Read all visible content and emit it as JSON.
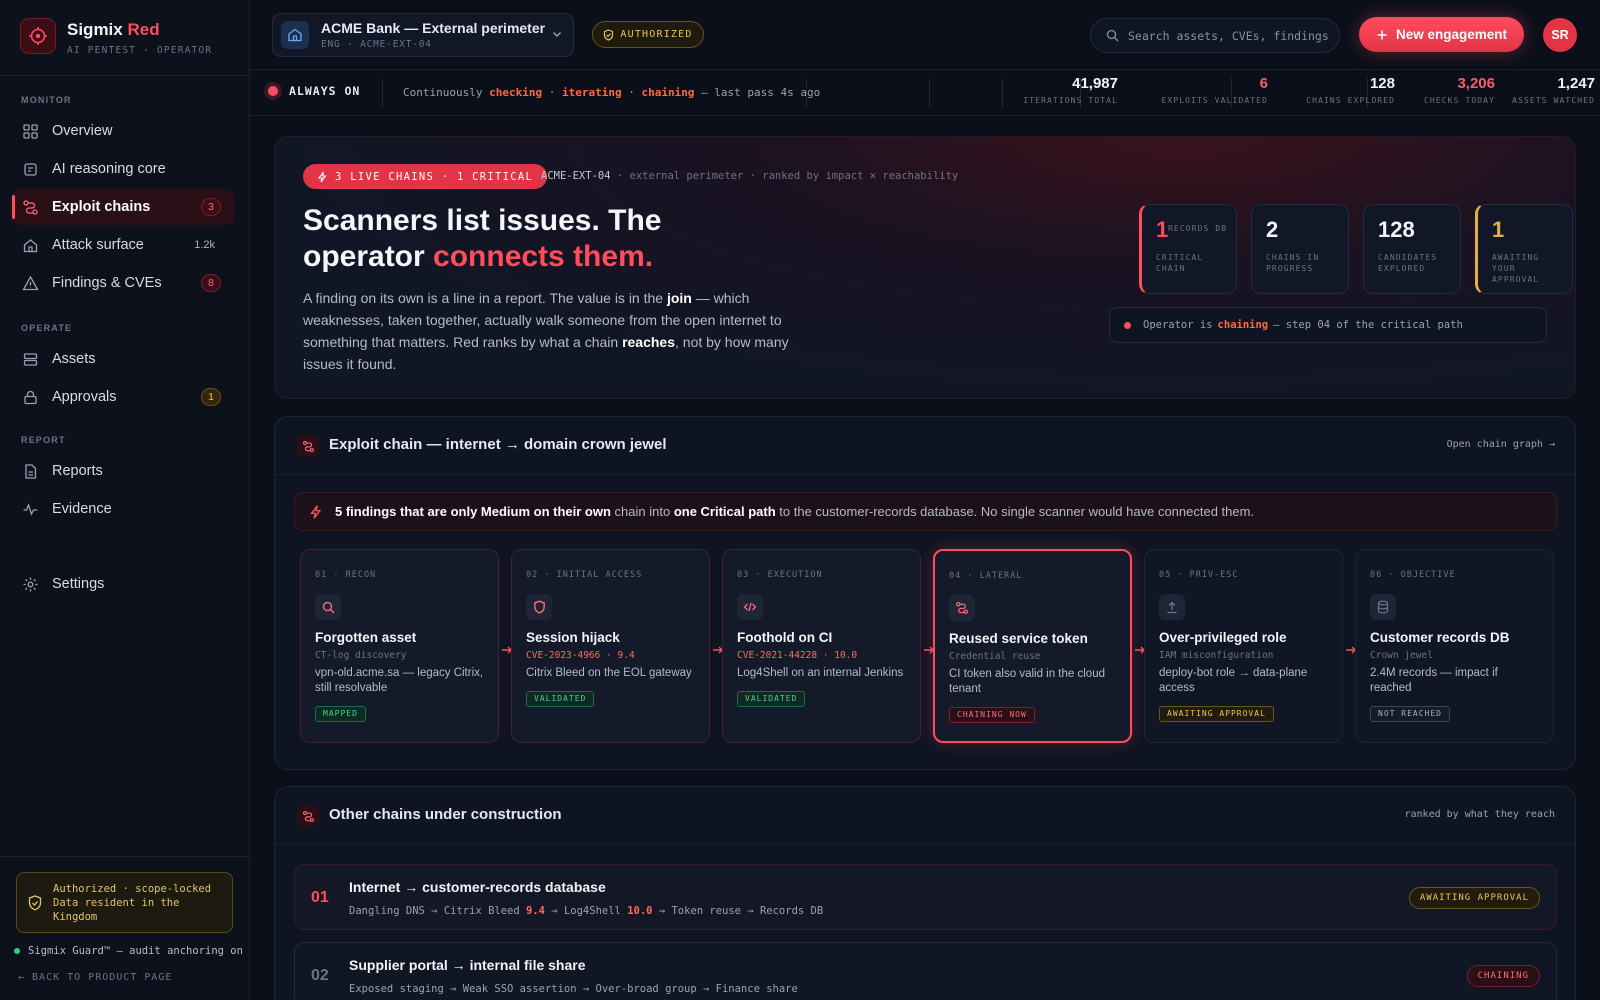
{
  "brand": {
    "name_main": "Sigmix",
    "name_accent": "Red",
    "subtitle": "AI PENTEST · OPERATOR"
  },
  "sidebar": {
    "sections": {
      "monitor": "MONITOR",
      "operate": "OPERATE",
      "report": "REPORT"
    },
    "items": [
      {
        "label": "Overview",
        "icon": "grid-icon"
      },
      {
        "label": "AI reasoning core",
        "icon": "chip-icon"
      },
      {
        "label": "Exploit chains",
        "icon": "route-icon",
        "badge": "3",
        "active": true
      },
      {
        "label": "Attack surface",
        "icon": "house-icon",
        "badge": "1.2k"
      },
      {
        "label": "Findings & CVEs",
        "icon": "warning-icon",
        "badge": "8"
      },
      {
        "label": "Assets",
        "icon": "server-icon"
      },
      {
        "label": "Approvals",
        "icon": "lock-icon",
        "badge": "1"
      },
      {
        "label": "Reports",
        "icon": "document-icon"
      },
      {
        "label": "Evidence",
        "icon": "pulse-icon"
      },
      {
        "label": "Settings",
        "icon": "gear-icon"
      }
    ],
    "auth_line1": "Authorized · scope-locked",
    "auth_line2": "Data resident in the Kingdom",
    "guard": "Sigmix Guard™ — audit anchoring on",
    "back": "← BACK TO PRODUCT PAGE"
  },
  "topbar": {
    "engagement_title": "ACME Bank — External perimeter",
    "engagement_sub": "ENG · ACME-EXT-04",
    "authorized": "AUTHORIZED",
    "search_placeholder": "Search assets, CVEs, findings…",
    "new_engagement": "New engagement",
    "avatar": "SR"
  },
  "status": {
    "always_on": "ALWAYS ON",
    "prefix": "Continuously",
    "w1": "checking",
    "w2": "iterating",
    "w3": "chaining",
    "suffix": "— last pass 4s ago",
    "sep": "·",
    "stats": [
      {
        "value": "1,247",
        "label": "ASSETS WATCHED",
        "color": "#f2f4f8"
      },
      {
        "value": "3,206",
        "label": "CHECKS TODAY",
        "color": "#ff5a66"
      },
      {
        "value": "128",
        "label": "CHAINS EXPLORED",
        "color": "#f2f4f8"
      },
      {
        "value": "6",
        "label": "EXPLOITS VALIDATED",
        "color": "#ff5a66"
      },
      {
        "value": "41,987",
        "label": "ITERATIONS TOTAL",
        "color": "#f2f4f8"
      }
    ]
  },
  "hero": {
    "pill": "3 LIVE CHAINS · 1 CRITICAL",
    "meta_id": "ACME-EXT-04",
    "meta_rest": "· external perimeter · ranked by impact × reachability",
    "title_a": "Scanners list issues. The operator",
    "title_b": "connects them.",
    "p1": "A finding on its own is a line in a report. The value is in the",
    "p_join": "join",
    "p2": "— which weaknesses, taken together, actually walk someone from the open internet to something that matters. Red ranks by what a chain",
    "p_reaches": "reaches",
    "p3": ", not by how many issues it found.",
    "kpis": [
      {
        "value": "1",
        "top": "RECORDS DB",
        "label": "CRITICAL CHAIN",
        "color": "#ff4d5e"
      },
      {
        "value": "2",
        "top": "",
        "label": "CHAINS IN PROGRESS",
        "color": "#f2f4f8"
      },
      {
        "value": "128",
        "top": "",
        "label": "CANDIDATES EXPLORED",
        "color": "#f2f4f8"
      },
      {
        "value": "1",
        "top": "",
        "label": "AWAITING YOUR APPROVAL",
        "color": "#e3b341"
      }
    ],
    "op_a": "Operator is",
    "op_b": "chaining",
    "op_c": "— step 04 of the critical path"
  },
  "chain": {
    "title": "Exploit chain — internet → domain crown jewel",
    "open": "Open chain graph →",
    "callout_a": "5 findings that are only Medium on their own",
    "callout_b": "chain into",
    "callout_c": "one Critical path",
    "callout_d": "to the customer-records database. No single scanner would have connected them.",
    "steps": [
      {
        "n": "01 · RECON",
        "icon": "search-icon",
        "title": "Forgotten asset",
        "sub": "CT-log discovery",
        "desc": "vpn-old.acme.sa — legacy Citrix, still resolvable",
        "tag": "MAPPED",
        "tone": "green",
        "state": "done"
      },
      {
        "n": "02 · INITIAL ACCESS",
        "icon": "shield-icon",
        "title": "Session hijack",
        "sub": "CVE-2023-4966 · 9.4",
        "desc": "Citrix Bleed on the EOL gateway",
        "tag": "VALIDATED",
        "tone": "green",
        "state": "done",
        "cve": true
      },
      {
        "n": "03 · EXECUTION",
        "icon": "code-icon",
        "title": "Foothold on CI",
        "sub": "CVE-2021-44228 · 10.0",
        "desc": "Log4Shell on an internal Jenkins",
        "tag": "VALIDATED",
        "tone": "green",
        "state": "done",
        "cve": true
      },
      {
        "n": "04 · LATERAL",
        "icon": "route-icon",
        "title": "Reused service token",
        "sub": "Credential reuse",
        "desc": "CI token also valid in the cloud tenant",
        "tag": "CHAINING NOW",
        "tone": "red",
        "state": "now"
      },
      {
        "n": "05 · PRIV-ESC",
        "icon": "upload-icon",
        "title": "Over-privileged role",
        "sub": "IAM misconfiguration",
        "desc": "deploy-bot role → data-plane access",
        "tag": "AWAITING APPROVAL",
        "tone": "amber",
        "state": "pend"
      },
      {
        "n": "06 · OBJECTIVE",
        "icon": "database-icon",
        "title": "Customer records DB",
        "sub": "Crown jewel",
        "desc": "2.4M records — impact if reached",
        "tag": "NOT REACHED",
        "tone": "grey",
        "state": "pend"
      }
    ]
  },
  "other": {
    "title": "Other chains under construction",
    "right": "ranked by what they reach",
    "rows": [
      {
        "n": "01",
        "title": "Internet → customer-records database",
        "p_a": "Dangling DNS → Citrix Bleed",
        "s1": "9.4",
        "p_b": "→ Log4Shell",
        "s2": "10.0",
        "p_c": "→ Token reuse → Records DB",
        "tag": "AWAITING APPROVAL",
        "tone": "amber"
      },
      {
        "n": "02",
        "title": "Supplier portal → internal file share",
        "p_a": "Exposed staging → Weak SSO assertion → Over-broad group → Finance share",
        "s1": "",
        "p_b": "",
        "s2": "",
        "p_c": "",
        "tag": "CHAINING",
        "tone": "red"
      }
    ]
  }
}
